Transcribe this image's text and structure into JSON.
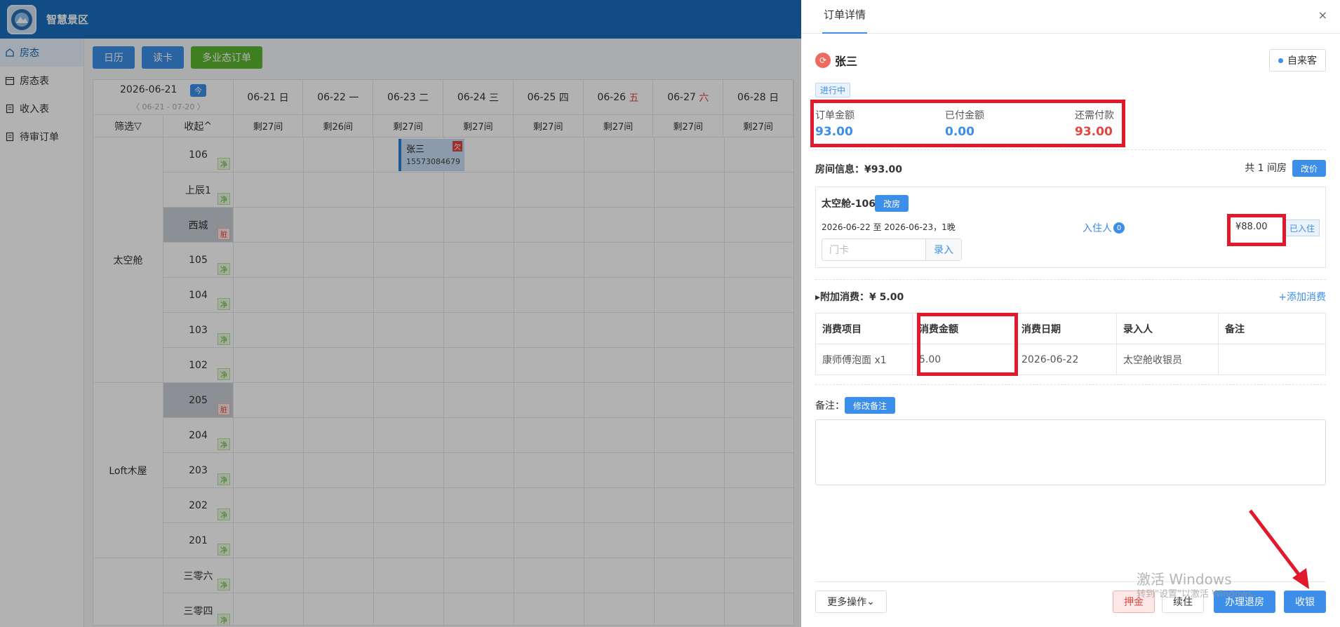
{
  "app": {
    "title": "智慧景区"
  },
  "sidebar": {
    "items": [
      {
        "label": "房态",
        "icon": "home-icon",
        "active": true
      },
      {
        "label": "房态表",
        "icon": "calendar-icon"
      },
      {
        "label": "收入表",
        "icon": "document-icon"
      },
      {
        "label": "待审订单",
        "icon": "document-icon"
      }
    ]
  },
  "toolbar": {
    "calendar": "日历",
    "readcard": "读卡",
    "multi_order": "多业态订单"
  },
  "grid": {
    "date": "2026-06-21",
    "today": "今",
    "range": "〈 06-21 - 07-20 〉",
    "days": [
      {
        "date": "06-21",
        "wk": "日",
        "weekend": false,
        "remain": "剩27间"
      },
      {
        "date": "06-22",
        "wk": "一",
        "weekend": false,
        "remain": "剩26间"
      },
      {
        "date": "06-23",
        "wk": "二",
        "weekend": false,
        "remain": "剩27间"
      },
      {
        "date": "06-24",
        "wk": "三",
        "weekend": false,
        "remain": "剩27间"
      },
      {
        "date": "06-25",
        "wk": "四",
        "weekend": false,
        "remain": "剩27间"
      },
      {
        "date": "06-26",
        "wk": "五",
        "weekend": true,
        "remain": "剩27间"
      },
      {
        "date": "06-27",
        "wk": "六",
        "weekend": true,
        "remain": "剩27间"
      },
      {
        "date": "06-28",
        "wk": "日",
        "weekend": false,
        "remain": "剩27间"
      }
    ],
    "filter": "筛选",
    "collapse": "收起",
    "types": [
      {
        "name": "太空舱",
        "rows": 7
      },
      {
        "name": "Loft木屋",
        "rows": 5
      },
      {
        "name": "",
        "rows": 2
      }
    ],
    "rooms": [
      {
        "name": "106",
        "tag": "净",
        "dirty": false
      },
      {
        "name": "上辰1",
        "tag": "净",
        "dirty": false
      },
      {
        "name": "西城",
        "tag": "脏",
        "dirty": true
      },
      {
        "name": "105",
        "tag": "净",
        "dirty": false
      },
      {
        "name": "104",
        "tag": "净",
        "dirty": false
      },
      {
        "name": "103",
        "tag": "净",
        "dirty": false
      },
      {
        "name": "102",
        "tag": "净",
        "dirty": false
      },
      {
        "name": "205",
        "tag": "脏",
        "dirty": true
      },
      {
        "name": "204",
        "tag": "净",
        "dirty": false
      },
      {
        "name": "203",
        "tag": "净",
        "dirty": false
      },
      {
        "name": "202",
        "tag": "净",
        "dirty": false
      },
      {
        "name": "201",
        "tag": "净",
        "dirty": false
      },
      {
        "name": "三零六",
        "tag": "净",
        "dirty": false
      },
      {
        "name": "三零四",
        "tag": "净",
        "dirty": false
      }
    ],
    "booking": {
      "name": "张三",
      "phone": "15573084679",
      "owe": "欠"
    }
  },
  "drawer": {
    "tab": "订单详情",
    "close": "×",
    "guest": "张三",
    "source": "自来客",
    "status": "进行中",
    "amounts": [
      {
        "label": "订单金额",
        "value": "93.00",
        "color": "blue"
      },
      {
        "label": "已付金额",
        "value": "0.00",
        "color": "blue"
      },
      {
        "label": "还需付款",
        "value": "93.00",
        "color": "red"
      }
    ],
    "room_info": "房间信息：¥93.00",
    "room_count": "共 1 间房",
    "change_price": "改价",
    "room": {
      "name": "太空舱-106",
      "change": "改房",
      "dates": "2026-06-22 至 2026-06-23，1晚",
      "guest_label": "入住人",
      "guest_count": "0",
      "price": "¥88.00",
      "checked_in": "已入住",
      "card_placeholder": "门卡",
      "card_btn": "录入"
    },
    "extra_title": "附加消费：¥ 5.00",
    "add_extra": "+添加消费",
    "extra_headers": [
      "消费项目",
      "消费金额",
      "消费日期",
      "录入人",
      "备注"
    ],
    "extra_rows": [
      [
        "康师傅泡面 x1",
        "5.00",
        "2026-06-22",
        "太空舱收银员",
        ""
      ]
    ],
    "remark_label": "备注：",
    "remark_btn": "修改备注",
    "footer": {
      "more": "更多操作",
      "deposit": "押金",
      "extend": "续住",
      "checkout": "办理退房",
      "cashier": "收银"
    }
  },
  "watermark": {
    "line1": "激活 Windows",
    "line2": "转到\"设置\"以激活 Windows。"
  },
  "colors": {
    "primary": "#3c8ee8",
    "topbar": "#1a6dbf",
    "green": "#5cb531",
    "red": "#e0473f",
    "highlight": "#e11a2b"
  }
}
